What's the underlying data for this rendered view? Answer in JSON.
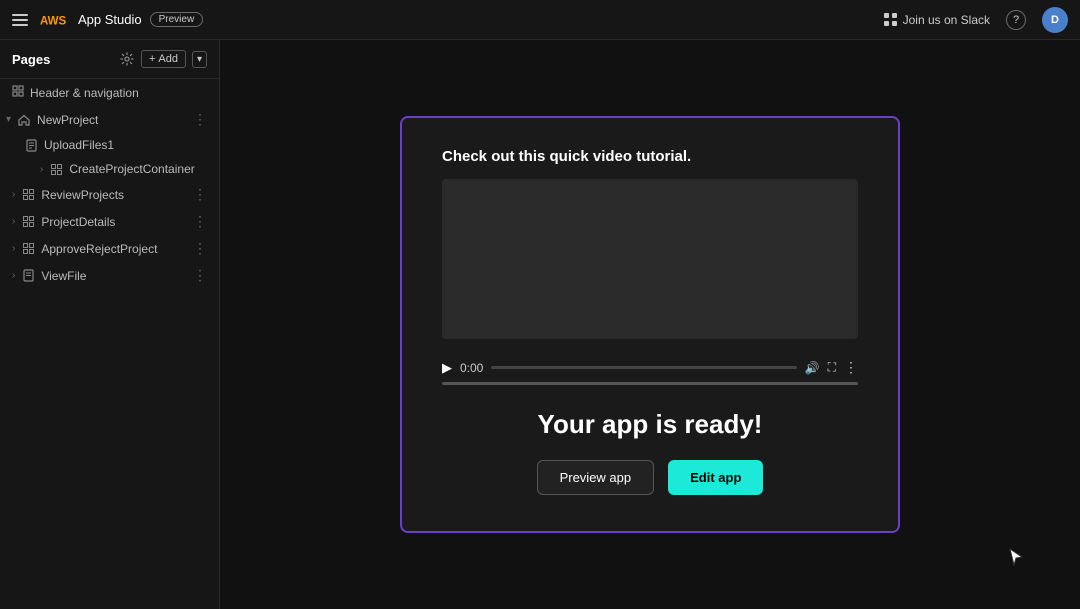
{
  "topnav": {
    "brand": "App Studio",
    "preview_badge": "Preview",
    "slack_link": "Join us on Slack",
    "help_label": "?",
    "user_initials": "D"
  },
  "sidebar": {
    "title": "Pages",
    "add_label": "Add",
    "nav_item_header": "Header & navigation",
    "pages": [
      {
        "label": "NewProject",
        "type": "home",
        "expanded": true,
        "has_more": true
      },
      {
        "label": "UploadFiles1",
        "type": "file",
        "indent": 1
      },
      {
        "label": "CreateProjectContainer",
        "type": "grid",
        "indent": 1,
        "has_chevron": true
      },
      {
        "label": "ReviewProjects",
        "type": "grid",
        "indent": 0,
        "has_more": true
      },
      {
        "label": "ProjectDetails",
        "type": "grid",
        "indent": 0,
        "has_more": true
      },
      {
        "label": "ApproveRejectProject",
        "type": "grid",
        "indent": 0,
        "has_more": true
      },
      {
        "label": "ViewFile",
        "type": "file",
        "indent": 0,
        "has_more": true
      }
    ]
  },
  "modal": {
    "video_label": "Check out this quick video tutorial.",
    "time": "0:00",
    "ready_title": "Your app is ready!",
    "btn_preview": "Preview app",
    "btn_edit": "Edit app"
  }
}
